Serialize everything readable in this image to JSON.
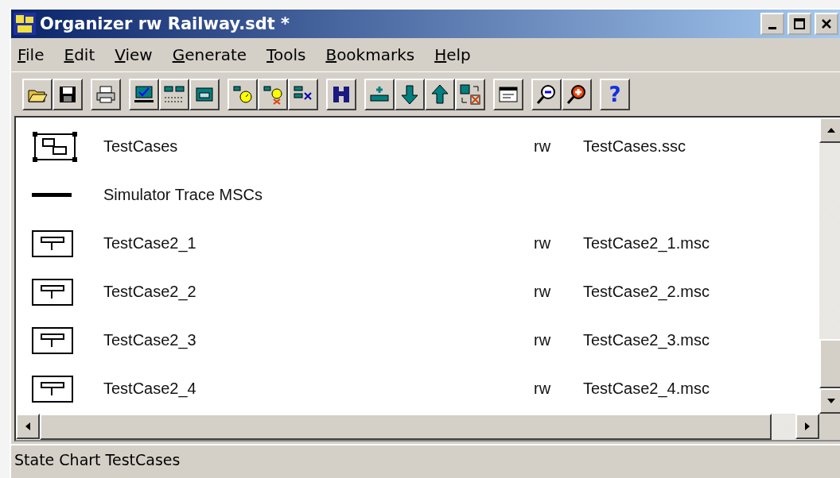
{
  "window": {
    "title": "Organizer rw Railway.sdt *"
  },
  "menu": [
    {
      "mnemonic": "F",
      "rest": "ile"
    },
    {
      "mnemonic": "E",
      "rest": "dit"
    },
    {
      "mnemonic": "V",
      "rest": "iew"
    },
    {
      "mnemonic": "G",
      "rest": "enerate"
    },
    {
      "mnemonic": "T",
      "rest": "ools"
    },
    {
      "mnemonic": "B",
      "rest": "ookmarks"
    },
    {
      "mnemonic": "H",
      "rest": "elp"
    }
  ],
  "toolbar": {
    "help_glyph": "?"
  },
  "rows": [
    {
      "kind": "state-chart",
      "name": "TestCases",
      "access": "rw",
      "file": "TestCases.ssc"
    },
    {
      "kind": "separator",
      "name": "Simulator Trace MSCs"
    },
    {
      "kind": "msc",
      "name": "TestCase2_1",
      "access": "rw",
      "file": "TestCase2_1.msc"
    },
    {
      "kind": "msc",
      "name": "TestCase2_2",
      "access": "rw",
      "file": "TestCase2_2.msc"
    },
    {
      "kind": "msc",
      "name": "TestCase2_3",
      "access": "rw",
      "file": "TestCase2_3.msc"
    },
    {
      "kind": "msc",
      "name": "TestCase2_4",
      "access": "rw",
      "file": "TestCase2_4.msc"
    }
  ],
  "status_bar": "State Chart TestCases"
}
